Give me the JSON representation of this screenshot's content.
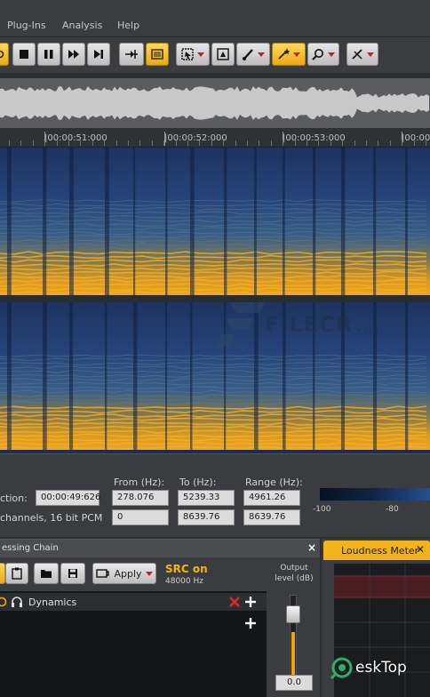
{
  "menu": {
    "items": [
      "Plug-Ins",
      "Analysis",
      "Help"
    ]
  },
  "toolbar": {
    "groups": [
      "transport",
      "snap",
      "selection-tools",
      "zoom",
      "markers"
    ],
    "accent_color": "#f2b31c"
  },
  "ruler": {
    "labels": [
      "|00:00:51:000",
      "|00:00:52:000",
      "|00:00:53:000",
      "|00:00"
    ]
  },
  "watermark": {
    "text": "FILECR",
    "suffix": ".com"
  },
  "info": {
    "selection_label": "ction:",
    "selection_value": "00:00:49:626",
    "format_label": "channels, 16 bit PCM",
    "format_value": "0",
    "from_label": "From (Hz):",
    "from_values": [
      "278.076",
      "0"
    ],
    "to_label": "To (Hz):",
    "to_values": [
      "5239.33",
      "8639.76"
    ],
    "range_label": "Range (Hz):",
    "range_values": [
      "4961.26",
      "8639.76"
    ],
    "colorbar_labels": [
      "-100",
      "-80"
    ]
  },
  "chain": {
    "title": "essing Chain",
    "close": "×",
    "apply_label": "Apply",
    "src_label": "SRC on",
    "src_rate": "48000 Hz",
    "output_label_1": "Output",
    "output_label_2": "level (dB)",
    "output_value": "0.0",
    "output_level_fraction": 0.55,
    "plugins": [
      {
        "name": "Dynamics"
      }
    ]
  },
  "loudness": {
    "title": "Loudness Meter",
    "close": "✕"
  },
  "logo": {
    "text": "eskTop"
  }
}
